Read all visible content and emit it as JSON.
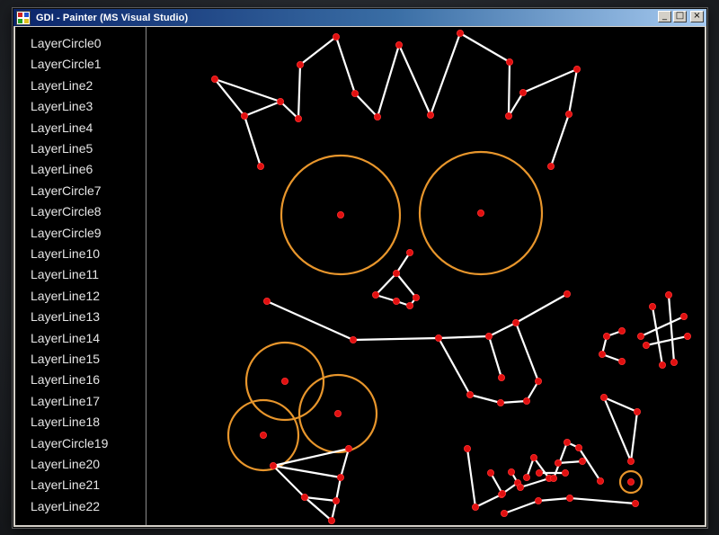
{
  "window": {
    "title": "GDI - Painter (MS Visual Studio)",
    "controls": {
      "minimize": "_",
      "maximize": "□",
      "close": "×"
    }
  },
  "layers": [
    "LayerCircle0",
    "LayerCircle1",
    "LayerLine2",
    "LayerLine3",
    "LayerLine4",
    "LayerLine5",
    "LayerLine6",
    "LayerCircle7",
    "LayerCircle8",
    "LayerCircle9",
    "LayerLine10",
    "LayerLine11",
    "LayerLine12",
    "LayerLine13",
    "LayerLine14",
    "LayerLine15",
    "LayerLine16",
    "LayerLine17",
    "LayerLine18",
    "LayerCircle19",
    "LayerLine20",
    "LayerLine21",
    "LayerLine22"
  ],
  "colors": {
    "canvas_background": "#000000",
    "line_color": "#ffffff",
    "circle_color": "#e8962c",
    "point_color": "#e01010"
  }
}
